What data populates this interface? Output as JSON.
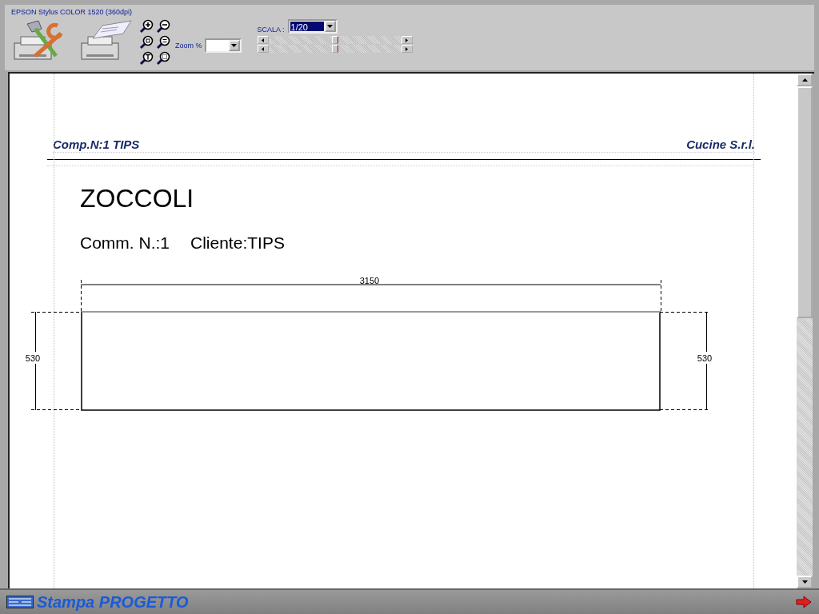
{
  "toolbar": {
    "printer_name": "EPSON Stylus COLOR 1520 (360dpi)",
    "zoom_label": "Zoom %",
    "scale_label": "SCALA :",
    "scale_value": "1/20",
    "sliders": [
      {
        "level": 0.5
      },
      {
        "level": 0.5
      }
    ]
  },
  "page": {
    "header_left": "Comp.N:1  TIPS",
    "header_right": "Cucine S.r.l.",
    "title": "ZOCCOLI",
    "order": "Comm. N.:1",
    "customer": "Cliente:TIPS",
    "drawing": {
      "width_label": "3150",
      "height_left_label": "530",
      "height_right_label": "530"
    }
  },
  "status_bar": {
    "title": "Stampa PROGETTO"
  }
}
